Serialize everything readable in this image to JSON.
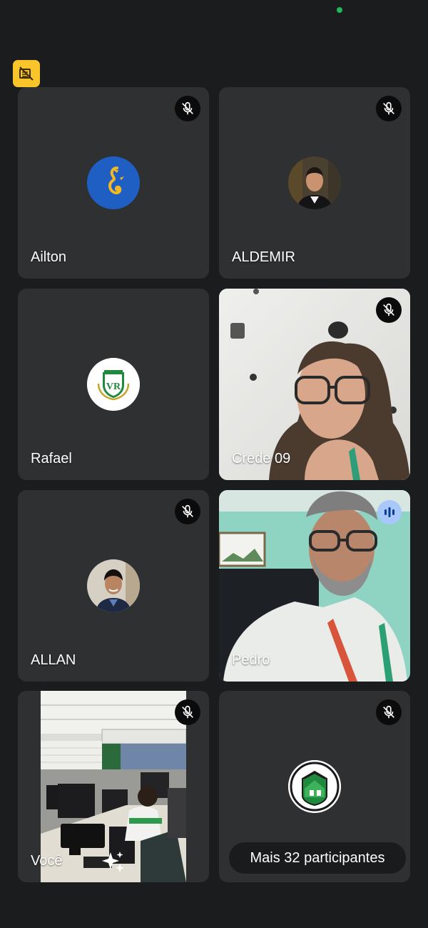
{
  "status": {
    "indicator_color": "#1fb85a"
  },
  "badge": {
    "icon": "no-camera-icon",
    "color": "#f9c52a"
  },
  "participants": [
    {
      "name": "Ailton",
      "mic_muted": true,
      "avatar": "seahorse-logo"
    },
    {
      "name": "ALDEMIR",
      "mic_muted": true,
      "avatar": "portrait-photo"
    },
    {
      "name": "Rafael",
      "mic_muted": false,
      "avatar": "school-crest-logo"
    },
    {
      "name": "Crede 09",
      "mic_muted": true,
      "avatar": "camera-video"
    },
    {
      "name": "ALLAN",
      "mic_muted": true,
      "avatar": "portrait-photo"
    },
    {
      "name": "Pedro",
      "mic_muted": false,
      "speaking": true,
      "avatar": "camera-video"
    },
    {
      "name": "Você",
      "mic_muted": true,
      "avatar": "camera-video-classroom"
    }
  ],
  "more": {
    "label": "Mais 32 participantes",
    "mic_muted": true,
    "avatar": "school-seal-logo"
  },
  "colors": {
    "tile": "#2f3032",
    "background": "#1b1c1e",
    "speaking": "#a8c7fa"
  }
}
